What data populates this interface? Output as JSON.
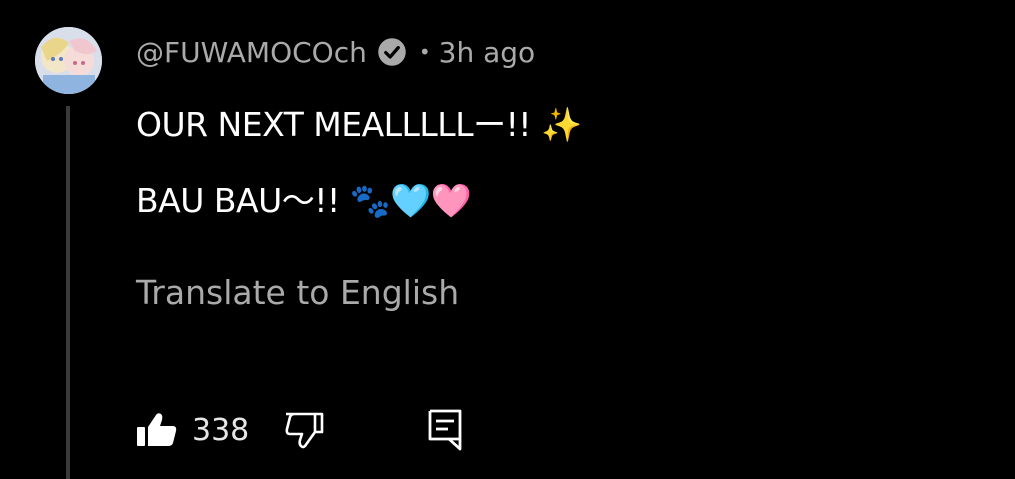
{
  "comment": {
    "author": "@FUWAMOCOch",
    "verified": true,
    "separator": "•",
    "timestamp": "3h ago",
    "lines": [
      "OUR NEXT MEALLLLLー!! ✨",
      "BAU BAU〜!! 🐾🩵🩷"
    ],
    "translate_label": "Translate to English",
    "like_count": "338"
  },
  "icons": {
    "verified": "verified-check-icon",
    "like": "thumbs-up-icon",
    "dislike": "thumbs-down-icon",
    "reply": "reply-comment-icon"
  },
  "colors": {
    "background": "#000000",
    "primary_text": "#ffffff",
    "secondary_text": "#aaaaaa",
    "thread_line": "#3a3a3a"
  }
}
